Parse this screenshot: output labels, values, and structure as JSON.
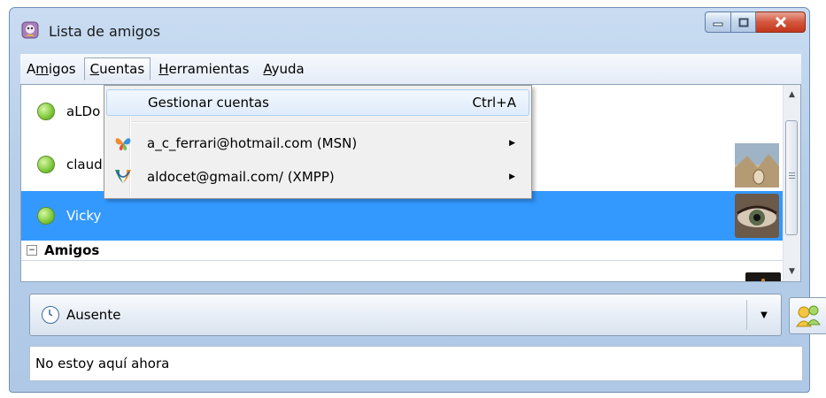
{
  "window": {
    "title": "Lista de amigos",
    "app_icon": "pidgin-icon"
  },
  "menubar": {
    "items": [
      {
        "id": "amigos",
        "pre": "A",
        "mnemonic": "m",
        "post": "igos"
      },
      {
        "id": "cuentas",
        "pre": "",
        "mnemonic": "C",
        "post": "uentas"
      },
      {
        "id": "herramientas",
        "pre": "",
        "mnemonic": "H",
        "post": "erramientas"
      },
      {
        "id": "ayuda",
        "pre": "",
        "mnemonic": "A",
        "post": "yuda"
      }
    ]
  },
  "cuentas_menu": {
    "manage_label": "Gestionar cuentas",
    "manage_shortcut": "Ctrl+A",
    "accounts": [
      {
        "label": "a_c_ferrari@hotmail.com (MSN)",
        "icon": "msn-butterfly-icon"
      },
      {
        "label": "aldocet@gmail.com/ (XMPP)",
        "icon": "xmpp-icon"
      }
    ]
  },
  "contacts": [
    {
      "name": "aLDo",
      "status": "available"
    },
    {
      "name": "claudia",
      "status": "available"
    },
    {
      "name": "Vicky",
      "status": "available",
      "selected": true
    }
  ],
  "group": {
    "name": "Amigos",
    "expander": "−"
  },
  "status": {
    "current": "Ausente",
    "message": "No estoy aquí ahora"
  },
  "colors": {
    "selection": "#3399ff",
    "window_frame": "#b7cfe9",
    "close_button": "#d4573d"
  }
}
